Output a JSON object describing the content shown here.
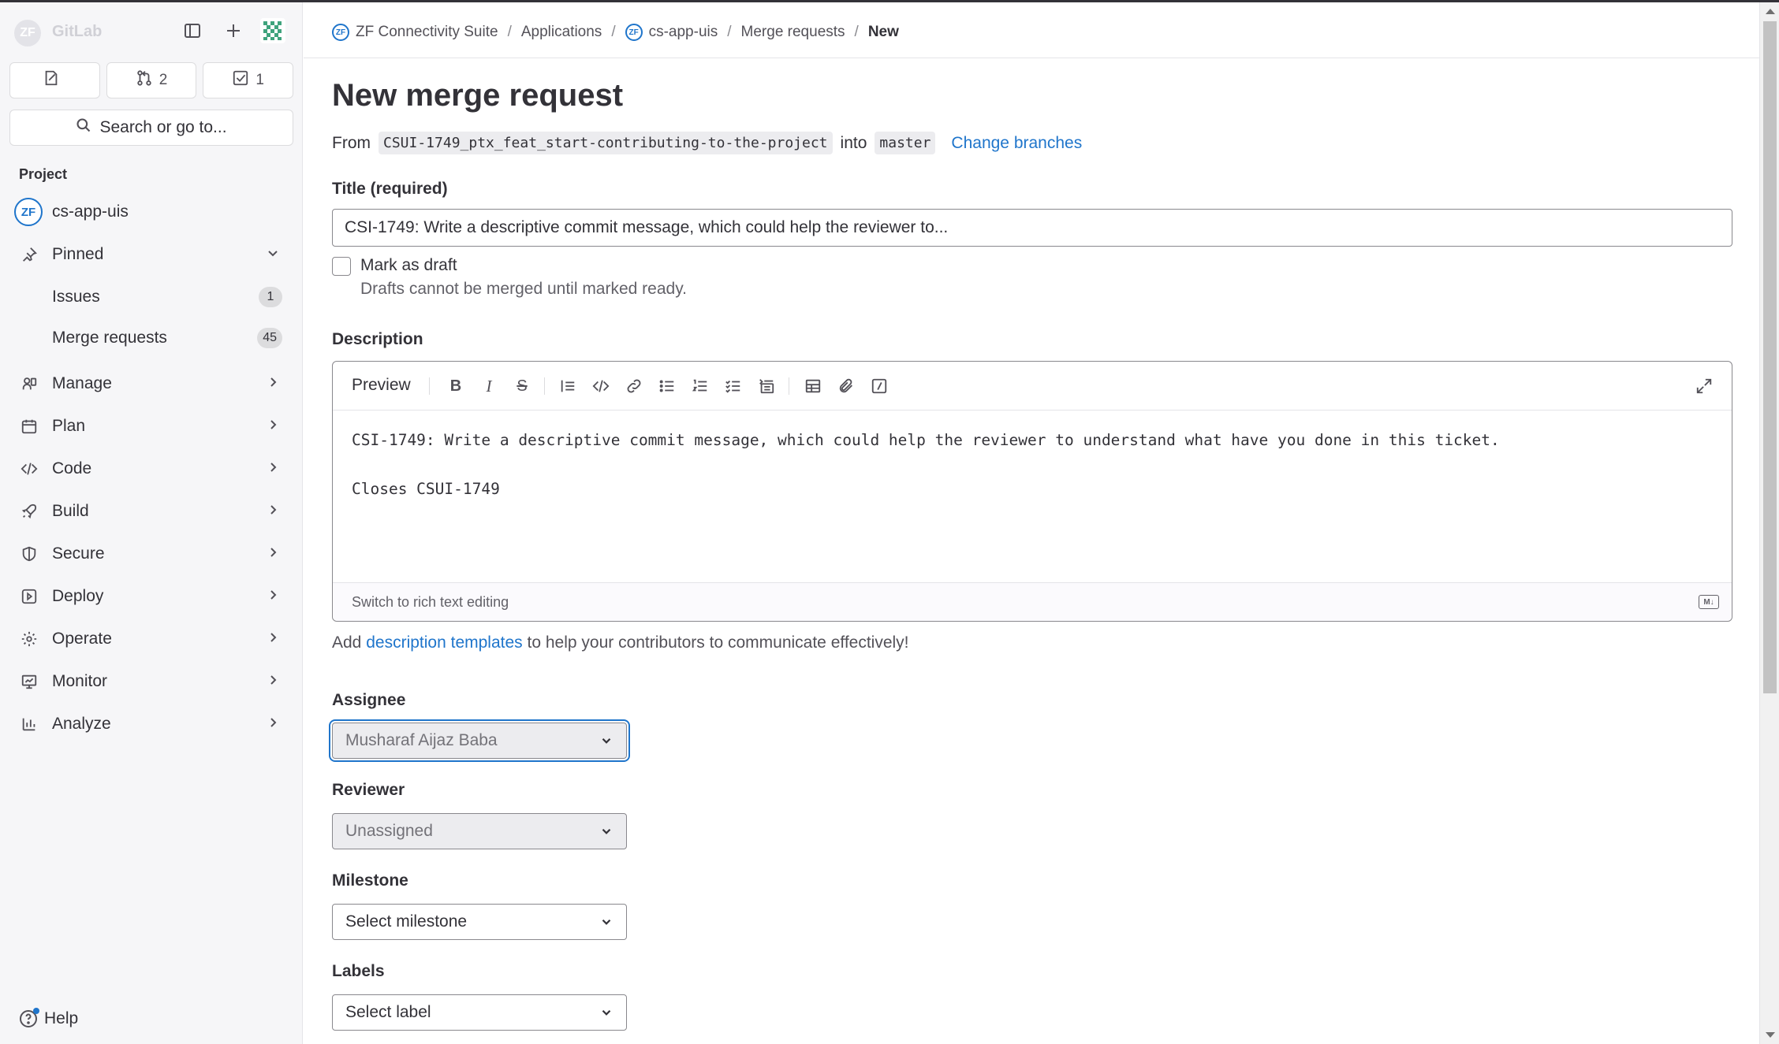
{
  "app": {
    "logo_text": "GitLab",
    "brand_color": "#1f75cb"
  },
  "sidebar": {
    "logo_initials": "ZF",
    "counts": [
      {
        "icon": "issues-icon",
        "value": ""
      },
      {
        "icon": "merge-request-icon",
        "value": "2"
      },
      {
        "icon": "todo-icon",
        "value": "1"
      }
    ],
    "search_label": "Search or go to...",
    "section_label": "Project",
    "project_name": "cs-app-uis",
    "pinned_label": "Pinned",
    "pinned_items": [
      {
        "label": "Issues",
        "count": "1"
      },
      {
        "label": "Merge requests",
        "count": "45"
      }
    ],
    "nav": [
      {
        "label": "Manage",
        "icon": "manage-icon"
      },
      {
        "label": "Plan",
        "icon": "plan-icon"
      },
      {
        "label": "Code",
        "icon": "code-icon"
      },
      {
        "label": "Build",
        "icon": "build-icon"
      },
      {
        "label": "Secure",
        "icon": "shield-icon"
      },
      {
        "label": "Deploy",
        "icon": "deploy-icon"
      },
      {
        "label": "Operate",
        "icon": "operate-icon"
      },
      {
        "label": "Monitor",
        "icon": "monitor-icon"
      },
      {
        "label": "Analyze",
        "icon": "analyze-icon"
      }
    ],
    "help_label": "Help"
  },
  "breadcrumb": {
    "items": [
      "ZF Connectivity Suite",
      "Applications",
      "cs-app-uis",
      "Merge requests",
      "New"
    ],
    "separator": "/"
  },
  "page": {
    "title": "New merge request",
    "from_label": "From",
    "source_branch": "CSUI-1749_ptx_feat_start-contributing-to-the-project",
    "into_label": "into",
    "target_branch": "master",
    "change_branches": "Change branches"
  },
  "form": {
    "title_label": "Title (required)",
    "title_value": "CSI-1749: Write a descriptive commit message, which could help the reviewer to...",
    "draft_label": "Mark as draft",
    "draft_help": "Drafts cannot be merged until marked ready.",
    "description_label": "Description",
    "editor": {
      "preview_label": "Preview",
      "lines": [
        "CSI-1749: Write a descriptive commit message, which could help the reviewer to understand what have you done in this ticket.",
        "",
        "Closes CSUI-1749"
      ],
      "switch_label": "Switch to rich text editing",
      "md_badge": "M↓"
    },
    "templates": {
      "prefix": "Add",
      "link": "description templates",
      "suffix": "to help your contributors to communicate effectively!"
    },
    "assignee_label": "Assignee",
    "assignee_value": "Musharaf Aijaz Baba",
    "reviewer_label": "Reviewer",
    "reviewer_value": "Unassigned",
    "milestone_label": "Milestone",
    "milestone_value": "Select milestone",
    "labels_label": "Labels",
    "labels_value": "Select label"
  }
}
